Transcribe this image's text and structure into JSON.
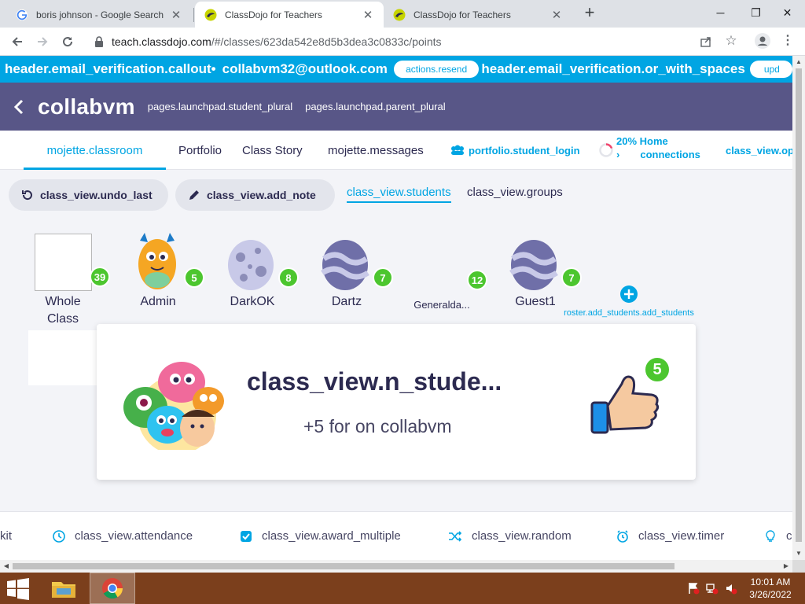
{
  "browser": {
    "tabs": [
      {
        "title": "boris johnson - Google Search",
        "active": false,
        "favicon": "google-icon"
      },
      {
        "title": "ClassDojo for Teachers",
        "active": true,
        "favicon": "classdojo-icon"
      },
      {
        "title": "ClassDojo for Teachers",
        "active": false,
        "favicon": "classdojo-icon"
      }
    ],
    "url_domain": "teach.classdojo.com",
    "url_path": "/#/classes/623da542e8d5b3dea3c0833c/points"
  },
  "header": {
    "email_verification_callout": "header.email_verification.callout•",
    "email": "collabvm32@outlook.com",
    "resend_label": "actions.resend",
    "or_with_spaces": "header.email_verification.or_with_spaces",
    "update_label": "upd"
  },
  "class_header": {
    "class_name": "collabvm",
    "student_plural": "pages.launchpad.student_plural",
    "parent_plural": "pages.launchpad.parent_plural"
  },
  "nav": {
    "classroom": "mojette.classroom",
    "portfolio": "Portfolio",
    "class_story": "Class Story",
    "messages": "mojette.messages",
    "student_login": "portfolio.student_login",
    "home_percent": "20%",
    "home_arrow": "›",
    "home_label_1": "Home",
    "home_label_2": "connections",
    "options": "class_view.op"
  },
  "controls": {
    "undo_last": "class_view.undo_last",
    "add_note": "class_view.add_note",
    "students_tab": "class_view.students",
    "groups_tab": "class_view.groups"
  },
  "students": [
    {
      "name": "Whole",
      "name2": "Class",
      "points": "39"
    },
    {
      "name": "Admin",
      "points": "5"
    },
    {
      "name": "DarkOK",
      "points": "8"
    },
    {
      "name": "Dartz",
      "points": "7"
    },
    {
      "name": "Generalda...",
      "points": "12"
    },
    {
      "name": "Guest1",
      "points": "7"
    }
  ],
  "add_students_label": "roster.add_students.add_students",
  "award": {
    "title": "class_view.n_stude...",
    "subtitle": "+5 for on collabvm",
    "points": "5"
  },
  "toolkit": {
    "kit": "kit",
    "attendance": "class_view.attendance",
    "award_multiple": "class_view.award_multiple",
    "random": "class_view.random",
    "timer": "class_view.timer",
    "last": "c"
  },
  "taskbar": {
    "time": "10:01 AM",
    "date": "3/26/2022"
  },
  "colors": {
    "classdojo_blue": "#00a5e3",
    "header_purple": "#585687",
    "points_green": "#4cc62f"
  }
}
